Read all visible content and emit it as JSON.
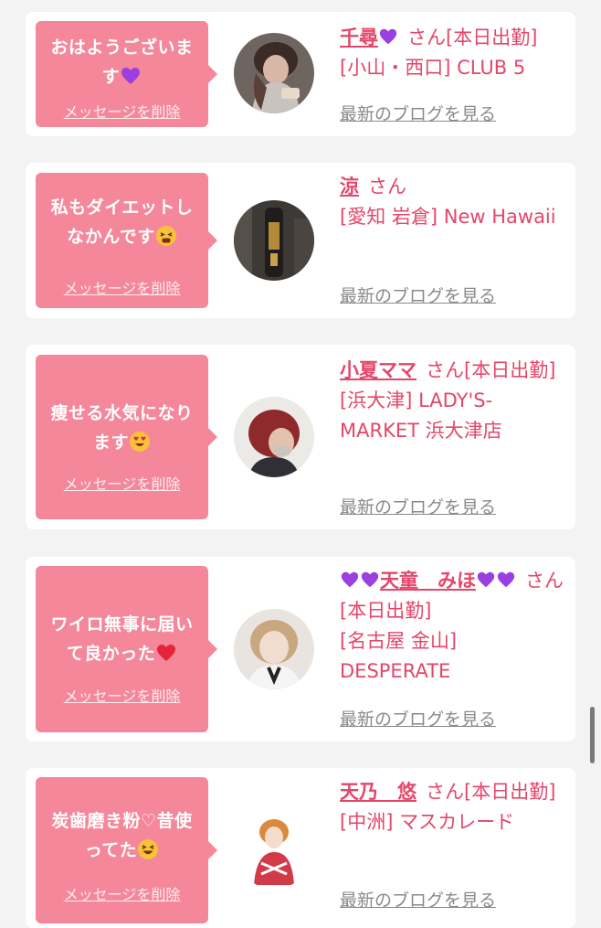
{
  "messages": [
    {
      "message": "おはようございます",
      "message_emoji": "purple-heart",
      "delete_label": "メッセージを削除",
      "name_prefix_emoji": "",
      "name": "千尋",
      "name_suffix_emoji": "purple-heart",
      "honorific": "さん",
      "status": "[本日出勤]",
      "location": "[小山・西口]",
      "shop": "CLUB 5",
      "blog_label": "最新のブログを見る"
    },
    {
      "message": "私もダイエットしなかんです",
      "message_emoji": "tired-face",
      "delete_label": "メッセージを削除",
      "name_prefix_emoji": "",
      "name": "涼",
      "name_suffix_emoji": "",
      "honorific": "さん",
      "status": "",
      "location": "[愛知 岩倉]",
      "shop": "New Hawaii",
      "blog_label": "最新のブログを見る"
    },
    {
      "message": "痩せる水気になります",
      "message_emoji": "heart-eyes",
      "delete_label": "メッセージを削除",
      "name_prefix_emoji": "",
      "name": "小夏ママ",
      "name_suffix_emoji": "",
      "honorific": "さん",
      "status": "[本日出勤]",
      "location": "[浜大津]",
      "shop": "LADY'S-MARKET 浜大津店",
      "blog_label": "最新のブログを見る"
    },
    {
      "message": "ワイロ無事に届いて良かった",
      "message_emoji": "red-heart",
      "delete_label": "メッセージを削除",
      "name_prefix_emoji": "purple-heart-x2",
      "name": "天童　みほ",
      "name_suffix_emoji": "purple-heart-x2",
      "honorific": "さん",
      "status": "[本日出勤]",
      "location": "[名古屋 金山]",
      "shop": "DESPERATE",
      "blog_label": "最新のブログを見る"
    },
    {
      "message": "炭歯磨き粉♡昔使ってた",
      "message_emoji": "laughing-face",
      "delete_label": "メッセージを削除",
      "name_prefix_emoji": "",
      "name": "天乃　悠",
      "name_suffix_emoji": "",
      "honorific": "さん",
      "status": "[本日出勤]",
      "location": "[中洲]",
      "shop": "マスカレード",
      "blog_label": "最新のブログを見る"
    }
  ],
  "colors": {
    "accent": "#e4466a",
    "bubble": "#f5879a",
    "link_gray": "#8a8a8a",
    "background": "#f3f3f3"
  }
}
